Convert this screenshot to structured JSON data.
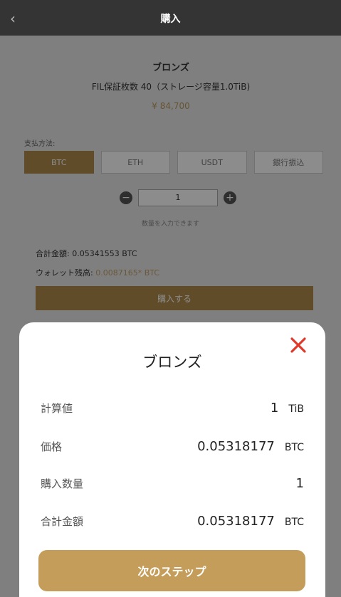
{
  "header": {
    "title": "購入",
    "back_icon": "chevron-left-icon"
  },
  "product": {
    "name": "ブロンズ",
    "description": "FIL保証枚数 40（ストレージ容量1.0TiB)",
    "price": "¥ 84,700"
  },
  "payment": {
    "label": "支払方法:",
    "methods": [
      "BTC",
      "ETH",
      "USDT",
      "銀行振込"
    ],
    "selected": "BTC"
  },
  "quantity": {
    "value": "1",
    "hint": "数量を入力できます"
  },
  "summary": {
    "total_label": "合計金額:",
    "total_value": "0.05341553 BTC",
    "wallet_label": "ウォレット残高:",
    "wallet_value": "0.0087165* BTC"
  },
  "buy_button": "購入する",
  "modal": {
    "title": "ブロンズ",
    "close_icon": "close-icon",
    "rows": [
      {
        "label": "計算値",
        "value": "1",
        "unit": "TiB"
      },
      {
        "label": "価格",
        "value": "0.05318177",
        "unit": "BTC"
      },
      {
        "label": "購入数量",
        "value": "1",
        "unit": ""
      },
      {
        "label": "合計金額",
        "value": "0.05318177",
        "unit": "BTC"
      }
    ],
    "next_button": "次のステップ"
  },
  "colors": {
    "accent": "#c59d5a",
    "close": "#e0392b",
    "topbar": "#343434"
  }
}
